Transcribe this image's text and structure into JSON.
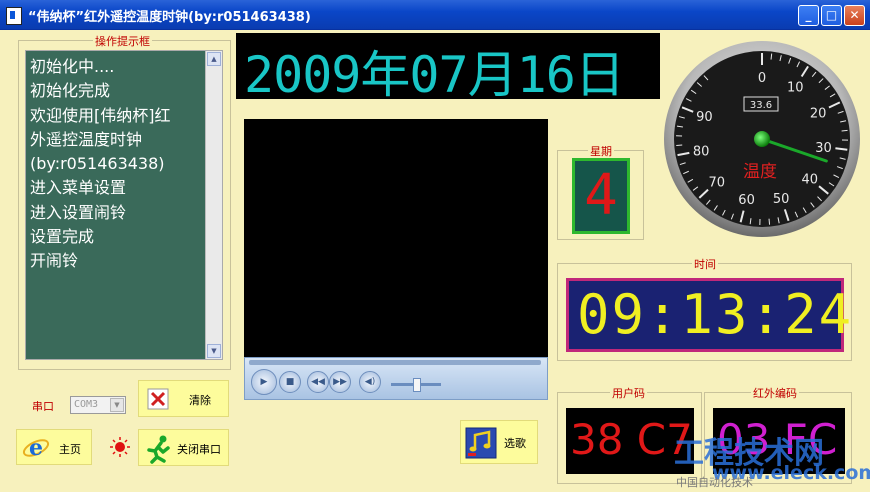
{
  "window": {
    "title": "“伟纳杯”红外遥控温度时钟(by:r051463438)",
    "min_glyph": "_",
    "max_glyph": "□",
    "close_glyph": "✕"
  },
  "log_panel": {
    "label": "操作提示框",
    "lines": [
      "初始化中....",
      "初始化完成",
      "欢迎使用[伟纳杯]红",
      "外遥控温度时钟",
      "(by:r051463438)",
      "进入菜单设置",
      "进入设置闹铃",
      "设置完成",
      "开闹铃"
    ]
  },
  "date_display": "2009年07月16日",
  "gauge": {
    "ticks": [
      "0",
      "10",
      "20",
      "30",
      "40",
      "50",
      "60",
      "70",
      "80",
      "90"
    ],
    "reading": "33.6",
    "value": 33.6,
    "label": "温度",
    "needle_color": "#1aa82a",
    "label_color": "#e02020"
  },
  "week": {
    "label": "星期",
    "value": "4"
  },
  "time": {
    "label": "时间",
    "value": "09:13:24"
  },
  "user_code": {
    "label": "用户码",
    "value": "38 C7",
    "color": "#e01818"
  },
  "ir_code": {
    "label": "红外编码",
    "value": "03 FC",
    "color": "#d020d0"
  },
  "controls": {
    "serial_label": "串口",
    "serial_port": "COM3",
    "clear_button": "清除",
    "home_button": "主页",
    "close_serial_button": "关闭串口",
    "choose_song_button": "选歌"
  },
  "watermark": {
    "line1": "工程技术网",
    "line2": "www.eleck.com",
    "line3": "中国自动化技术"
  }
}
